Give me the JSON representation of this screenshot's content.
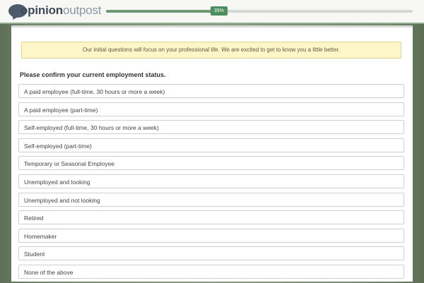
{
  "brand": {
    "part1": "opinion",
    "part2": "outpost"
  },
  "progress": {
    "label": "35%",
    "fraction": 0.35
  },
  "notice": "Our initial questions will focus on your professional life. We are excited to get to know you a little better.",
  "question": "Please confirm your current employment status.",
  "options": [
    {
      "label": "A paid employee (full-time, 30 hours or more a week)"
    },
    {
      "label": "A paid employee (part-time)"
    },
    {
      "label": "Self-employed (full-time, 30 hours or more a week)"
    },
    {
      "label": "Self-employed (part-time)"
    },
    {
      "label": "Temporary or Seasonal Employee"
    },
    {
      "label": "Unemployed and looking"
    },
    {
      "label": "Unemployed and not looking"
    },
    {
      "label": "Retired"
    },
    {
      "label": "Homemaker"
    },
    {
      "label": "Student"
    },
    {
      "label": "None of the above"
    }
  ]
}
